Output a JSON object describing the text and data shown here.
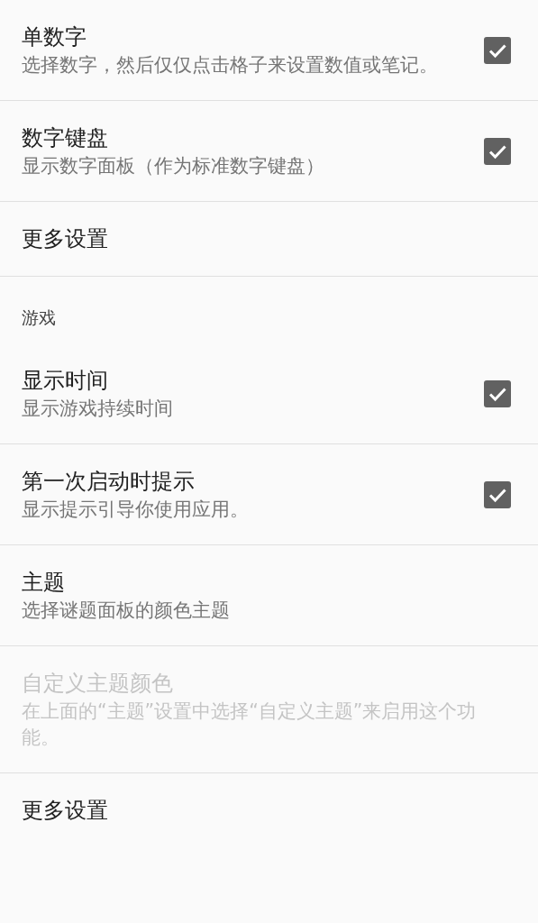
{
  "settings": [
    {
      "kind": "preference",
      "title": "单数字",
      "summary": "选择数字，然后仅仅点击格子来设置数值或笔记。",
      "checkbox": true,
      "checked": true,
      "disabled": false
    },
    {
      "kind": "preference",
      "title": "数字键盘",
      "summary": "显示数字面板（作为标准数字键盘）",
      "checkbox": true,
      "checked": true,
      "disabled": false
    },
    {
      "kind": "preference",
      "title": "更多设置",
      "checkbox": false,
      "disabled": false
    },
    {
      "kind": "category",
      "title": "游戏"
    },
    {
      "kind": "preference",
      "title": "显示时间",
      "summary": "显示游戏持续时间",
      "checkbox": true,
      "checked": true,
      "disabled": false
    },
    {
      "kind": "preference",
      "title": "第一次启动时提示",
      "summary": "显示提示引导你使用应用。",
      "checkbox": true,
      "checked": true,
      "disabled": false
    },
    {
      "kind": "preference",
      "title": "主题",
      "summary": "选择谜题面板的颜色主题",
      "checkbox": false,
      "disabled": false
    },
    {
      "kind": "preference",
      "title": "自定义主题颜色",
      "summary": "在上面的“主题”设置中选择“自定义主题”来启用这个功能。",
      "checkbox": false,
      "disabled": true
    },
    {
      "kind": "preference",
      "title": "更多设置",
      "checkbox": false,
      "disabled": false
    }
  ]
}
